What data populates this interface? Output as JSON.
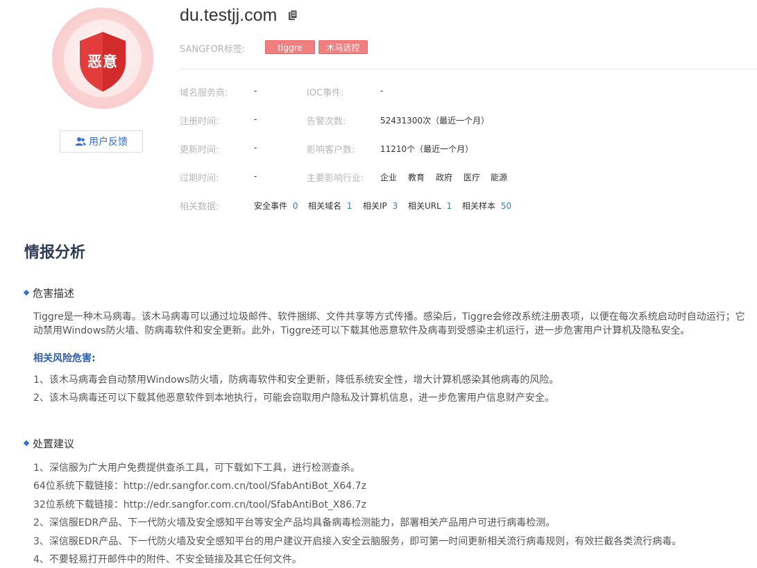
{
  "header": {
    "domain": "du.testjj.com",
    "badge_text": "恶意",
    "tag_label": "SANGFOR标签:",
    "tags": [
      "tiggre",
      "木马远控"
    ],
    "feedback_label": "用户反馈"
  },
  "info": {
    "registrar_label": "域名服务商:",
    "registrar_value": "-",
    "ioc_label": "IOC事件:",
    "ioc_value": "-",
    "reg_time_label": "注册时间:",
    "reg_time_value": "-",
    "alerts_label": "告警次数:",
    "alerts_value": "52431300次（最近一个月）",
    "update_time_label": "更新时间:",
    "update_time_value": "-",
    "customers_label": "影响客户数:",
    "customers_value": "11210个（最近一个月）",
    "expire_time_label": "过期时间:",
    "expire_time_value": "-",
    "industry_label": "主要影响行业:",
    "industries": [
      "企业",
      "教育",
      "政府",
      "医疗",
      "能源"
    ],
    "related_label": "相关数据:",
    "related": [
      {
        "label": "安全事件",
        "count": "0"
      },
      {
        "label": "相关域名",
        "count": "1"
      },
      {
        "label": "相关IP",
        "count": "3"
      },
      {
        "label": "相关URL",
        "count": "1"
      },
      {
        "label": "相关样本",
        "count": "50"
      }
    ]
  },
  "analysis": {
    "title": "情报分析",
    "harm_heading": "危害描述",
    "harm_line1": "Tiggre是一种木马病毒。该木马病毒可以通过垃圾邮件、软件捆绑、文件共享等方式传播。感染后，Tiggre会修改系统注册表项，以便在每次系统启动时自动运行；它",
    "harm_line2": "动禁用Windows防火墙、防病毒软件和安全更新。此外，Tiggre还可以下载其他恶意软件及病毒到受感染主机运行，进一步危害用户计算机及隐私安全。",
    "risk_title": "相关风险危害:",
    "risk1": "1、该木马病毒会自动禁用Windows防火墙，防病毒软件和安全更新，降低系统安全性，增大计算机感染其他病毒的风险。",
    "risk2": "2、该木马病毒还可以下载其他恶意软件到本地执行，可能会窃取用户隐私及计算机信息，进一步危害用户信息财产安全。",
    "advice_heading": "处置建议",
    "advice1": "1、深信服为广大用户免费提供查杀工具，可下载如下工具，进行检测查杀。",
    "advice_64": "64位系统下载链接：http://edr.sangfor.com.cn/tool/SfabAntiBot_X64.7z",
    "advice_32": "32位系统下载链接：http://edr.sangfor.com.cn/tool/SfabAntiBot_X86.7z",
    "advice2": "2、深信服EDR产品、下一代防火墙及安全感知平台等安全产品均具备病毒检测能力，部署相关产品用户可进行病毒检测。",
    "advice3": "3、深信服EDR产品、下一代防火墙及安全感知平台的用户建议开启接入安全云脑服务，即可第一时间更新相关流行病毒规则，有效拦截各类流行病毒。",
    "advice4": "4、不要轻易打开邮件中的附件、不安全链接及其它任何文件。"
  }
}
